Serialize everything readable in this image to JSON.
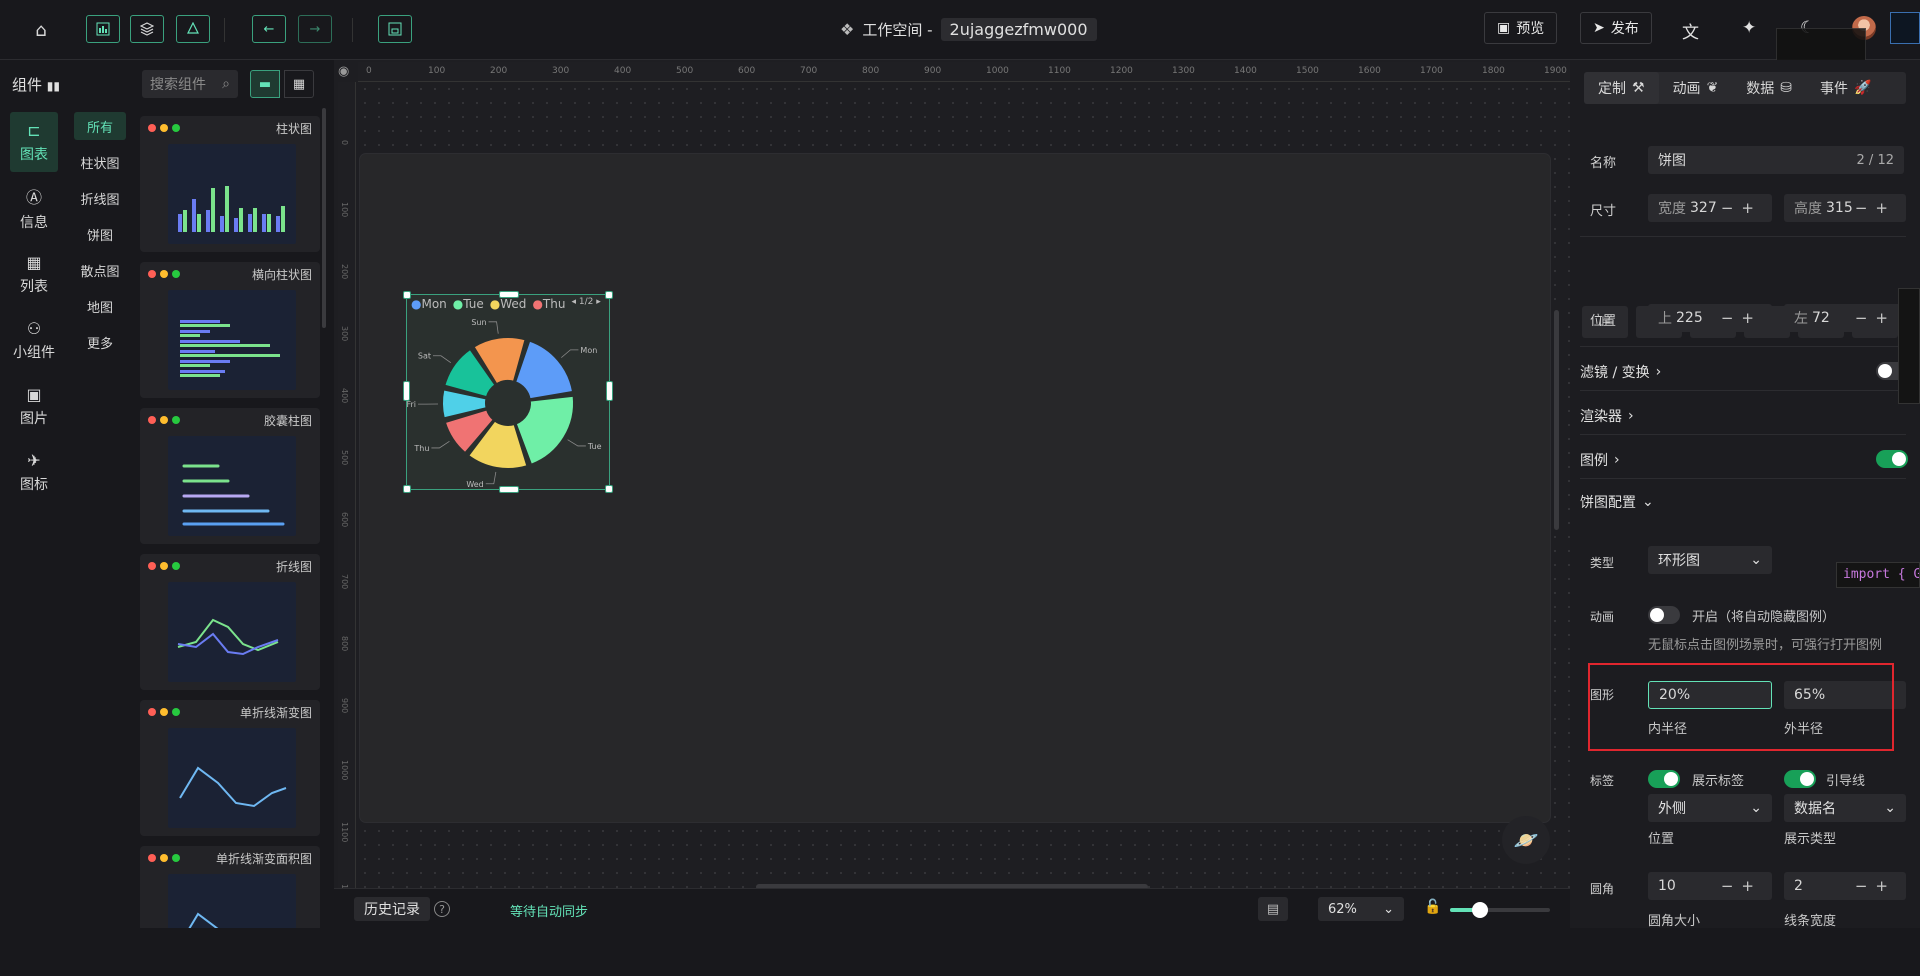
{
  "header": {
    "workspace_label": "工作空间 -",
    "workspace_name": "2ujaggezfmw000",
    "preview_label": "预览",
    "publish_label": "发布"
  },
  "components_panel": {
    "title": "组件",
    "search_placeholder": "搜索组件",
    "nav": [
      {
        "label": "图表",
        "icon": "chart-icon"
      },
      {
        "label": "信息",
        "icon": "info-icon"
      },
      {
        "label": "列表",
        "icon": "table-icon"
      },
      {
        "label": "小组件",
        "icon": "widget-icon"
      },
      {
        "label": "图片",
        "icon": "image-icon"
      },
      {
        "label": "图标",
        "icon": "plane-icon"
      }
    ],
    "categories": [
      "所有",
      "柱状图",
      "折线图",
      "饼图",
      "散点图",
      "地图",
      "更多"
    ],
    "cards": [
      {
        "title": "柱状图"
      },
      {
        "title": "横向柱状图"
      },
      {
        "title": "胶囊柱图"
      },
      {
        "title": "折线图"
      },
      {
        "title": "单折线渐变图"
      },
      {
        "title": "单折线渐变面积图"
      }
    ]
  },
  "canvas": {
    "ruler_ticks": [
      "0",
      "100",
      "200",
      "300",
      "400",
      "500",
      "600",
      "700",
      "800",
      "900",
      "1000",
      "1100",
      "1200",
      "1300",
      "1400",
      "1500",
      "1600",
      "1700",
      "1800",
      "1900"
    ],
    "ruler_left_ticks": [
      "0",
      "100",
      "200",
      "300",
      "400",
      "500",
      "600",
      "700",
      "800",
      "900",
      "1000",
      "1100",
      "1200"
    ],
    "legend": [
      "Mon",
      "Tue",
      "Wed",
      "Thu"
    ],
    "legend_page": "1/2",
    "slices": [
      {
        "label": "Mon",
        "value": 18,
        "color": "#5d9cf8"
      },
      {
        "label": "Tue",
        "value": 22,
        "color": "#6fefa7"
      },
      {
        "label": "Wed",
        "value": 16,
        "color": "#f2d55e"
      },
      {
        "label": "Thu",
        "value": 10,
        "color": "#f07373"
      },
      {
        "label": "Fri",
        "value": 8,
        "color": "#4fd0e8"
      },
      {
        "label": "Sat",
        "value": 12,
        "color": "#18c29a"
      },
      {
        "label": "Sun",
        "value": 14,
        "color": "#f3954e"
      }
    ]
  },
  "bottom": {
    "history_label": "历史记录",
    "sync_status": "等待自动同步",
    "zoom": "62%"
  },
  "settings": {
    "tabs": [
      "定制",
      "动画",
      "数据",
      "事件"
    ],
    "name_label": "名称",
    "name_value": "饼图",
    "name_count": "2 / 12",
    "size_label": "尺寸",
    "width_label": "宽度",
    "width_value": "327",
    "height_label": "高度",
    "height_value": "315",
    "position_label": "位置",
    "top_label": "上",
    "top_value": "225",
    "left_label": "左",
    "left_value": "72",
    "filter_label": "滤镜 / 变换",
    "renderer_label": "渲染器",
    "legend_label": "图例",
    "pie_config_label": "饼图配置",
    "type_label": "类型",
    "type_value": "环形图",
    "animation_label": "动画",
    "animation_toggle_label": "开启（将自动隐藏图例）",
    "animation_hint": "无鼠标点击图例场景时，可强行打开图例",
    "shape_label": "图形",
    "inner_radius": "20%",
    "outer_radius": "65%",
    "inner_label": "内半径",
    "outer_label": "外半径",
    "label_label": "标签",
    "show_label": "展示标签",
    "guide_line": "引导线",
    "label_position": "外侧",
    "display_type": "数据名",
    "position_sub": "位置",
    "display_sub": "展示类型",
    "corner_label": "圆角",
    "corner_value": "10",
    "line_width_value": "2",
    "corner_sub": "圆角大小",
    "line_width_sub": "线条宽度"
  },
  "overlay_code": "import { G"
}
